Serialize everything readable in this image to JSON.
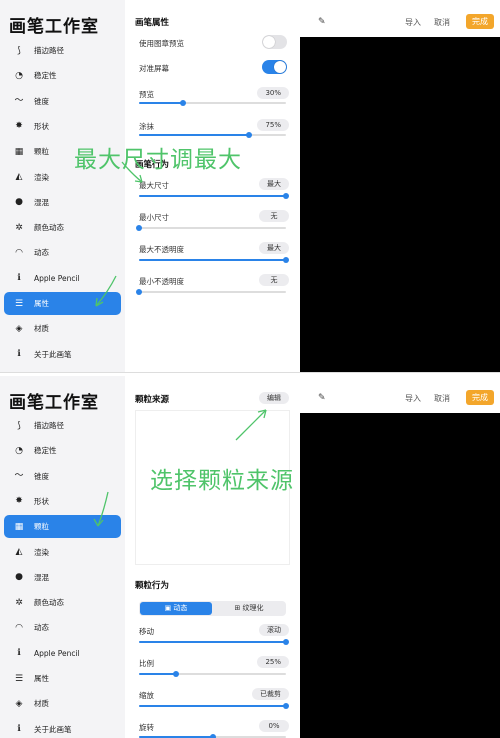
{
  "app_title": "画笔工作室",
  "sidebar": {
    "items": [
      {
        "label": "描边路径",
        "icon": "stroke-path-icon",
        "glyph": "⟆"
      },
      {
        "label": "稳定性",
        "icon": "stabilization-icon",
        "glyph": "◔"
      },
      {
        "label": "锥度",
        "icon": "taper-icon",
        "glyph": "〜"
      },
      {
        "label": "形状",
        "icon": "shape-icon",
        "glyph": "✸"
      },
      {
        "label": "颗粒",
        "icon": "grain-icon",
        "glyph": "▦"
      },
      {
        "label": "渲染",
        "icon": "rendering-icon",
        "glyph": "◭"
      },
      {
        "label": "湿混",
        "icon": "wet-mix-icon",
        "glyph": "●"
      },
      {
        "label": "颜色动态",
        "icon": "color-dynamics-icon",
        "glyph": "✲"
      },
      {
        "label": "动态",
        "icon": "dynamics-icon",
        "glyph": "◠"
      },
      {
        "label": "Apple Pencil",
        "icon": "apple-pencil-icon",
        "glyph": "ℹ"
      },
      {
        "label": "属性",
        "icon": "properties-icon",
        "glyph": "☰"
      },
      {
        "label": "材质",
        "icon": "materials-icon",
        "glyph": "◈"
      },
      {
        "label": "关于此画笔",
        "icon": "about-icon",
        "glyph": "ℹ"
      }
    ]
  },
  "topbar": {
    "import": "导入",
    "cancel": "取消",
    "done": "完成"
  },
  "panel1": {
    "selected_index": 10,
    "section1_title": "画笔属性",
    "toggles": [
      {
        "label": "使用图章预览",
        "on": false
      },
      {
        "label": "对准屏幕",
        "on": true
      }
    ],
    "sliders1": [
      {
        "label": "预览",
        "value": "30%",
        "fill": 0.3
      },
      {
        "label": "涂抹",
        "value": "75%",
        "fill": 0.75
      }
    ],
    "section2_title": "画笔行为",
    "sliders2": [
      {
        "label": "最大尺寸",
        "value": "最大",
        "fill": 1.0
      },
      {
        "label": "最小尺寸",
        "value": "无",
        "fill": 0.0
      },
      {
        "label": "最大不透明度",
        "value": "最大",
        "fill": 1.0
      },
      {
        "label": "最小不透明度",
        "value": "无",
        "fill": 0.0
      }
    ],
    "annotation": "最大尺寸调最大"
  },
  "panel2": {
    "selected_index": 4,
    "grain_source_title": "颗粒来源",
    "edit_label": "编辑",
    "grain_behavior_title": "颗粒行为",
    "segments": {
      "active": "动态",
      "inactive": "纹理化"
    },
    "sliders": [
      {
        "label": "移动",
        "value": "滚动",
        "fill": 1.0
      },
      {
        "label": "比例",
        "value": "25%",
        "fill": 0.25
      },
      {
        "label": "缩放",
        "value": "已裁剪",
        "fill": 1.0
      },
      {
        "label": "旋转",
        "value": "0%",
        "fill": 0.5
      }
    ],
    "annotation": "选择颗粒来源"
  }
}
